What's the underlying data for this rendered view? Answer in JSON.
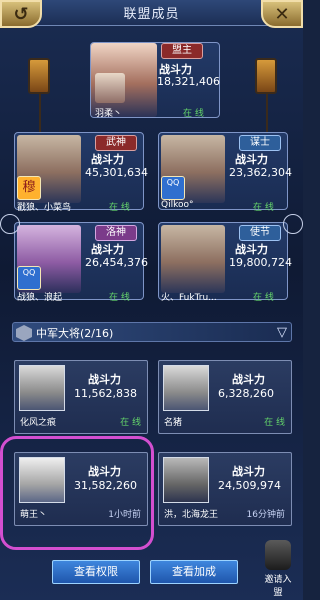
{
  "header": {
    "title": "联盟成员"
  },
  "leader": {
    "role": "盟主",
    "power_label": "战斗力",
    "power": "18,321,406",
    "name": "羽柔丶",
    "status": "在 线"
  },
  "officers": [
    {
      "role": "武神",
      "power_label": "战斗力",
      "power": "45,301,634",
      "name": "戳狼、小菜鸟",
      "status": "在 线"
    },
    {
      "role": "谋士",
      "power_label": "战斗力",
      "power": "23,362,304",
      "name": "Qilkoo°",
      "status": "在 线"
    },
    {
      "role": "洛神",
      "power_label": "战斗力",
      "power": "26,454,376",
      "name": "战狼、浪起",
      "status": "在 线"
    },
    {
      "role": "使节",
      "power_label": "战斗力",
      "power": "19,800,724",
      "name": "火、FukTru...",
      "status": "在 线"
    }
  ],
  "section": {
    "title": "中军大将(2/16)"
  },
  "members": [
    {
      "power_label": "战斗力",
      "power": "11,562,838",
      "name": "化风之痕",
      "status": "在 线"
    },
    {
      "power_label": "战斗力",
      "power": "6,328,260",
      "name": "名猪",
      "status": "在 线"
    },
    {
      "power_label": "战斗力",
      "power": "31,582,260",
      "name": "萌王丶",
      "status": "1小时前"
    },
    {
      "power_label": "战斗力",
      "power": "24,509,974",
      "name": "洪，北海龙王",
      "status": "16分钟前"
    }
  ],
  "buttons": {
    "view_perms": "查看权限",
    "view_bonus": "查看加成",
    "invite": "邀请入盟"
  },
  "colors": {
    "online": "#63d36a",
    "highlight": "#d34fd0"
  }
}
